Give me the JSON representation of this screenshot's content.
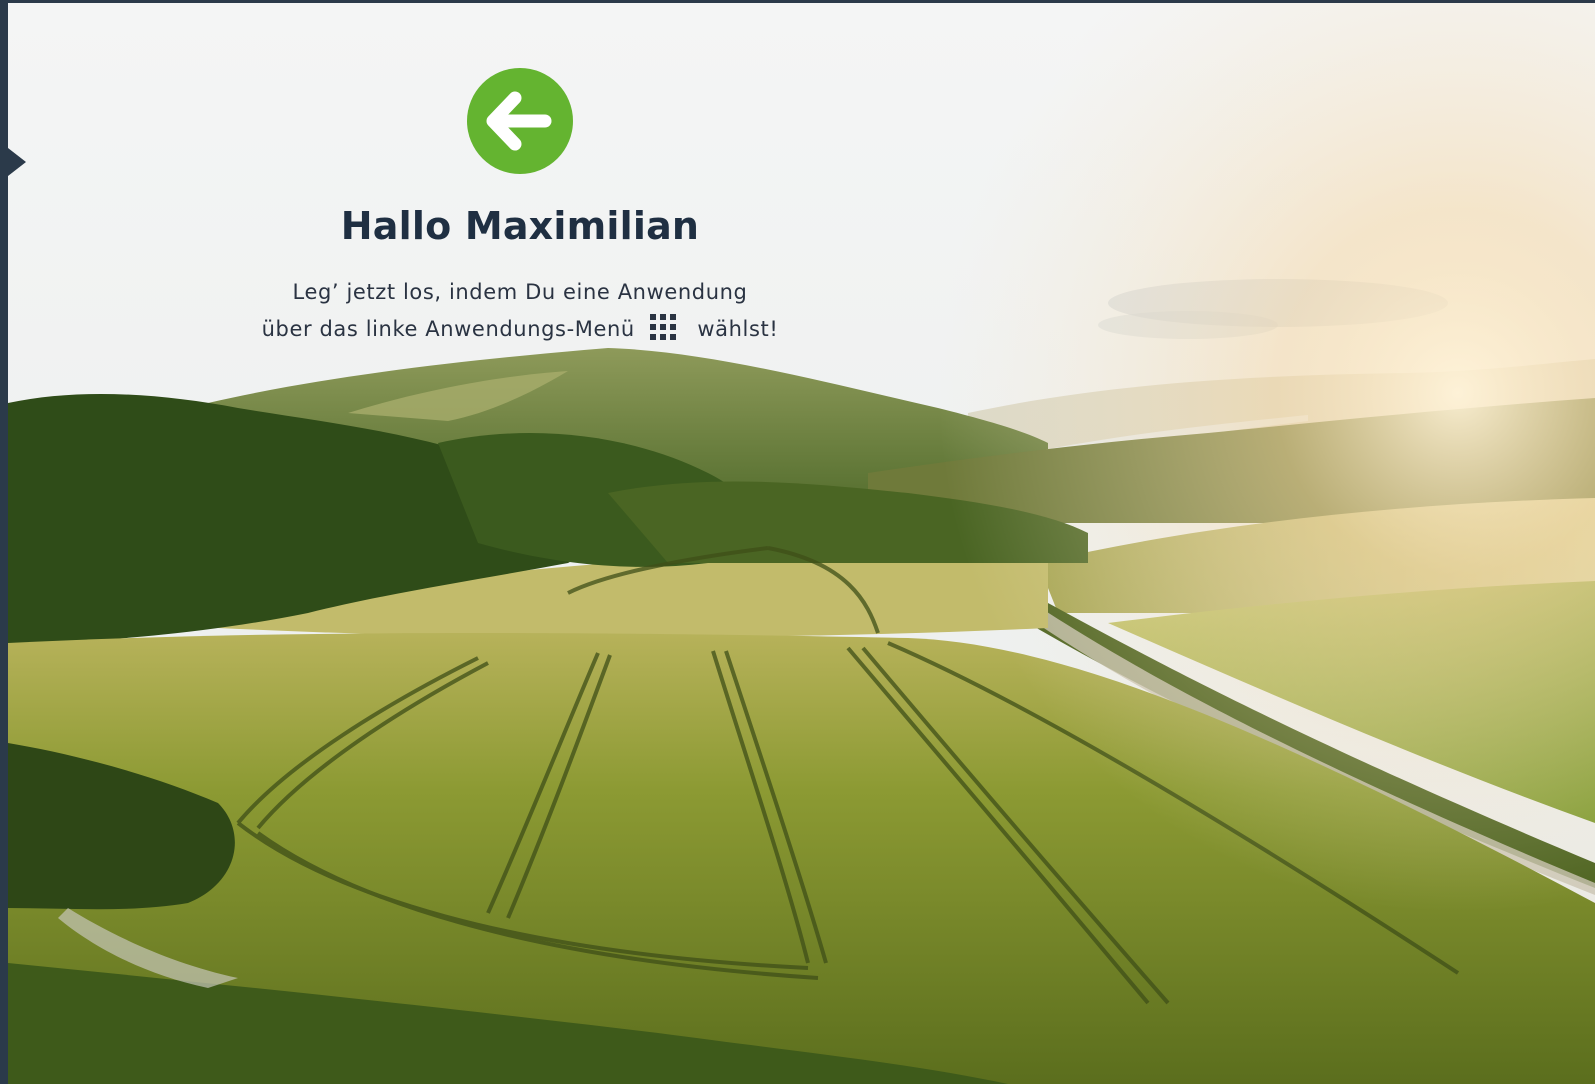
{
  "colors": {
    "accent_green": "#64b430",
    "heading": "#1f2f42",
    "body_text": "#2a3342",
    "rail": "#2b3a4a"
  },
  "icons": {
    "back": "arrow-left-circle-icon",
    "apps_menu": "grid-apps-icon",
    "rail_toggle": "chevron-right-icon"
  },
  "hero": {
    "greeting": "Hallo Maximilian",
    "line1": "Leg’ jetzt los, indem Du eine Anwendung",
    "line2_before_icon": "über das linke Anwendungs-Menü",
    "line2_after_icon": "wählst!"
  }
}
